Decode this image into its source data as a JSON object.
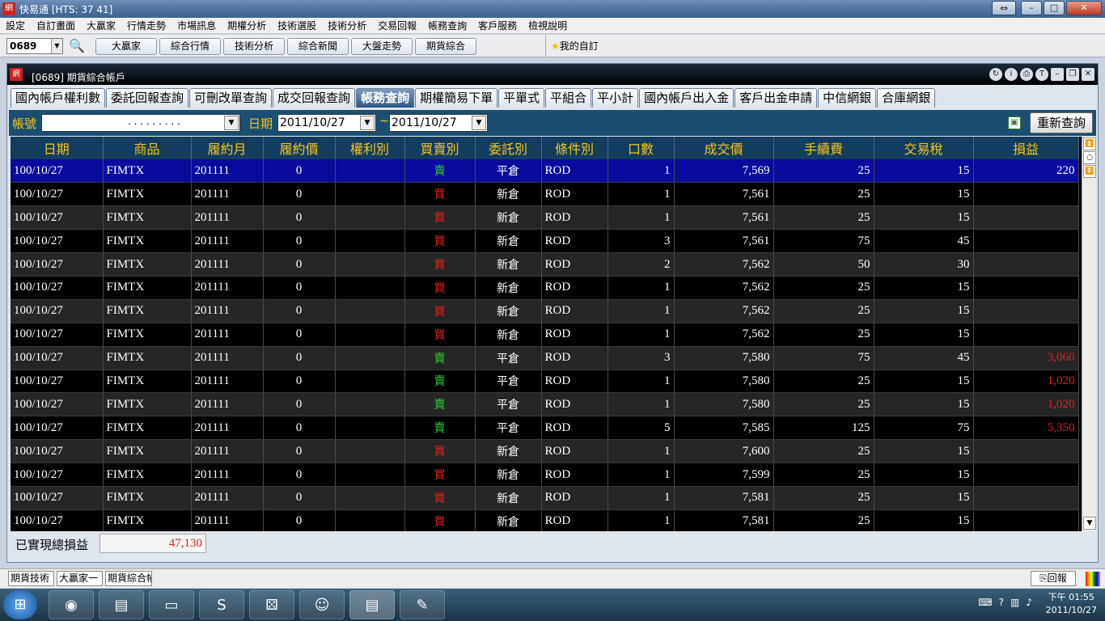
{
  "window": {
    "title": "快易通 [HTS: 37 41]",
    "logo": "網"
  },
  "menu": [
    "設定",
    "自訂畫面",
    "大贏家",
    "行情走勢",
    "市場訊息",
    "期權分析",
    "技術選股",
    "技術分析",
    "交易回報",
    "帳務查詢",
    "客戶服務",
    "檢視說明"
  ],
  "toolbar": {
    "stock_code": "0689",
    "buttons": [
      "大贏家",
      "綜合行情",
      "技術分析",
      "綜合新聞",
      "大盤走勢",
      "期貨綜合"
    ],
    "favorites_label": "我的自訂"
  },
  "inner": {
    "title": "[0689] 期貨綜合帳戶",
    "tabs": [
      "國內帳戶權利數",
      "委託回報查詢",
      "可刪改單查詢",
      "成交回報查詢",
      "帳務查詢",
      "期權簡易下單",
      "平單式",
      "平組合",
      "平小計",
      "國內帳戶出入金",
      "客戶出金申請",
      "中信網銀",
      "合庫網銀"
    ],
    "active_tab": "帳務查詢"
  },
  "filter": {
    "account_label": "帳號",
    "account_value": ". . . . . . . . .",
    "date_label": "日期",
    "date_from": "2011/10/27",
    "date_to": "2011/10/27",
    "tilde": "~",
    "requery_label": "重新查詢"
  },
  "grid": {
    "columns": [
      "日期",
      "商品",
      "履約月",
      "履約價",
      "權利別",
      "買賣別",
      "委託別",
      "條件別",
      "口數",
      "成交價",
      "手續費",
      "交易稅",
      "損益"
    ],
    "rows": [
      {
        "date": "100/10/27",
        "product": "FIMTX",
        "month": "201111",
        "strike": "0",
        "right": "",
        "side": "賣",
        "order": "平倉",
        "cond": "ROD",
        "qty": "1",
        "price": "7,569",
        "fee": "25",
        "tax": "15",
        "pnl": "220"
      },
      {
        "date": "100/10/27",
        "product": "FIMTX",
        "month": "201111",
        "strike": "0",
        "right": "",
        "side": "買",
        "order": "新倉",
        "cond": "ROD",
        "qty": "1",
        "price": "7,561",
        "fee": "25",
        "tax": "15",
        "pnl": ""
      },
      {
        "date": "100/10/27",
        "product": "FIMTX",
        "month": "201111",
        "strike": "0",
        "right": "",
        "side": "買",
        "order": "新倉",
        "cond": "ROD",
        "qty": "1",
        "price": "7,561",
        "fee": "25",
        "tax": "15",
        "pnl": ""
      },
      {
        "date": "100/10/27",
        "product": "FIMTX",
        "month": "201111",
        "strike": "0",
        "right": "",
        "side": "買",
        "order": "新倉",
        "cond": "ROD",
        "qty": "3",
        "price": "7,561",
        "fee": "75",
        "tax": "45",
        "pnl": ""
      },
      {
        "date": "100/10/27",
        "product": "FIMTX",
        "month": "201111",
        "strike": "0",
        "right": "",
        "side": "買",
        "order": "新倉",
        "cond": "ROD",
        "qty": "2",
        "price": "7,562",
        "fee": "50",
        "tax": "30",
        "pnl": ""
      },
      {
        "date": "100/10/27",
        "product": "FIMTX",
        "month": "201111",
        "strike": "0",
        "right": "",
        "side": "買",
        "order": "新倉",
        "cond": "ROD",
        "qty": "1",
        "price": "7,562",
        "fee": "25",
        "tax": "15",
        "pnl": ""
      },
      {
        "date": "100/10/27",
        "product": "FIMTX",
        "month": "201111",
        "strike": "0",
        "right": "",
        "side": "買",
        "order": "新倉",
        "cond": "ROD",
        "qty": "1",
        "price": "7,562",
        "fee": "25",
        "tax": "15",
        "pnl": ""
      },
      {
        "date": "100/10/27",
        "product": "FIMTX",
        "month": "201111",
        "strike": "0",
        "right": "",
        "side": "買",
        "order": "新倉",
        "cond": "ROD",
        "qty": "1",
        "price": "7,562",
        "fee": "25",
        "tax": "15",
        "pnl": ""
      },
      {
        "date": "100/10/27",
        "product": "FIMTX",
        "month": "201111",
        "strike": "0",
        "right": "",
        "side": "賣",
        "order": "平倉",
        "cond": "ROD",
        "qty": "3",
        "price": "7,580",
        "fee": "75",
        "tax": "45",
        "pnl": "3,060"
      },
      {
        "date": "100/10/27",
        "product": "FIMTX",
        "month": "201111",
        "strike": "0",
        "right": "",
        "side": "賣",
        "order": "平倉",
        "cond": "ROD",
        "qty": "1",
        "price": "7,580",
        "fee": "25",
        "tax": "15",
        "pnl": "1,020"
      },
      {
        "date": "100/10/27",
        "product": "FIMTX",
        "month": "201111",
        "strike": "0",
        "right": "",
        "side": "賣",
        "order": "平倉",
        "cond": "ROD",
        "qty": "1",
        "price": "7,580",
        "fee": "25",
        "tax": "15",
        "pnl": "1,020"
      },
      {
        "date": "100/10/27",
        "product": "FIMTX",
        "month": "201111",
        "strike": "0",
        "right": "",
        "side": "賣",
        "order": "平倉",
        "cond": "ROD",
        "qty": "5",
        "price": "7,585",
        "fee": "125",
        "tax": "75",
        "pnl": "5,350"
      },
      {
        "date": "100/10/27",
        "product": "FIMTX",
        "month": "201111",
        "strike": "0",
        "right": "",
        "side": "買",
        "order": "新倉",
        "cond": "ROD",
        "qty": "1",
        "price": "7,600",
        "fee": "25",
        "tax": "15",
        "pnl": ""
      },
      {
        "date": "100/10/27",
        "product": "FIMTX",
        "month": "201111",
        "strike": "0",
        "right": "",
        "side": "買",
        "order": "新倉",
        "cond": "ROD",
        "qty": "1",
        "price": "7,599",
        "fee": "25",
        "tax": "15",
        "pnl": ""
      },
      {
        "date": "100/10/27",
        "product": "FIMTX",
        "month": "201111",
        "strike": "0",
        "right": "",
        "side": "買",
        "order": "新倉",
        "cond": "ROD",
        "qty": "1",
        "price": "7,581",
        "fee": "25",
        "tax": "15",
        "pnl": ""
      },
      {
        "date": "100/10/27",
        "product": "FIMTX",
        "month": "201111",
        "strike": "0",
        "right": "",
        "side": "買",
        "order": "新倉",
        "cond": "ROD",
        "qty": "1",
        "price": "7,581",
        "fee": "25",
        "tax": "15",
        "pnl": ""
      }
    ]
  },
  "summary": {
    "label": "已實現總損益",
    "value": "47,130"
  },
  "statusbar": {
    "tabs": [
      "期貨技術",
      "大贏家一",
      "期貨綜合帳戶"
    ],
    "report_label": "回報"
  },
  "taskbar": {
    "clock_time": "下午 01:55",
    "clock_date": "2011/10/27"
  },
  "colors": {
    "buy": "#e02020",
    "sell": "#2ec82e",
    "header_text": "#f5c518",
    "selected_row": "#0a0a9e"
  }
}
